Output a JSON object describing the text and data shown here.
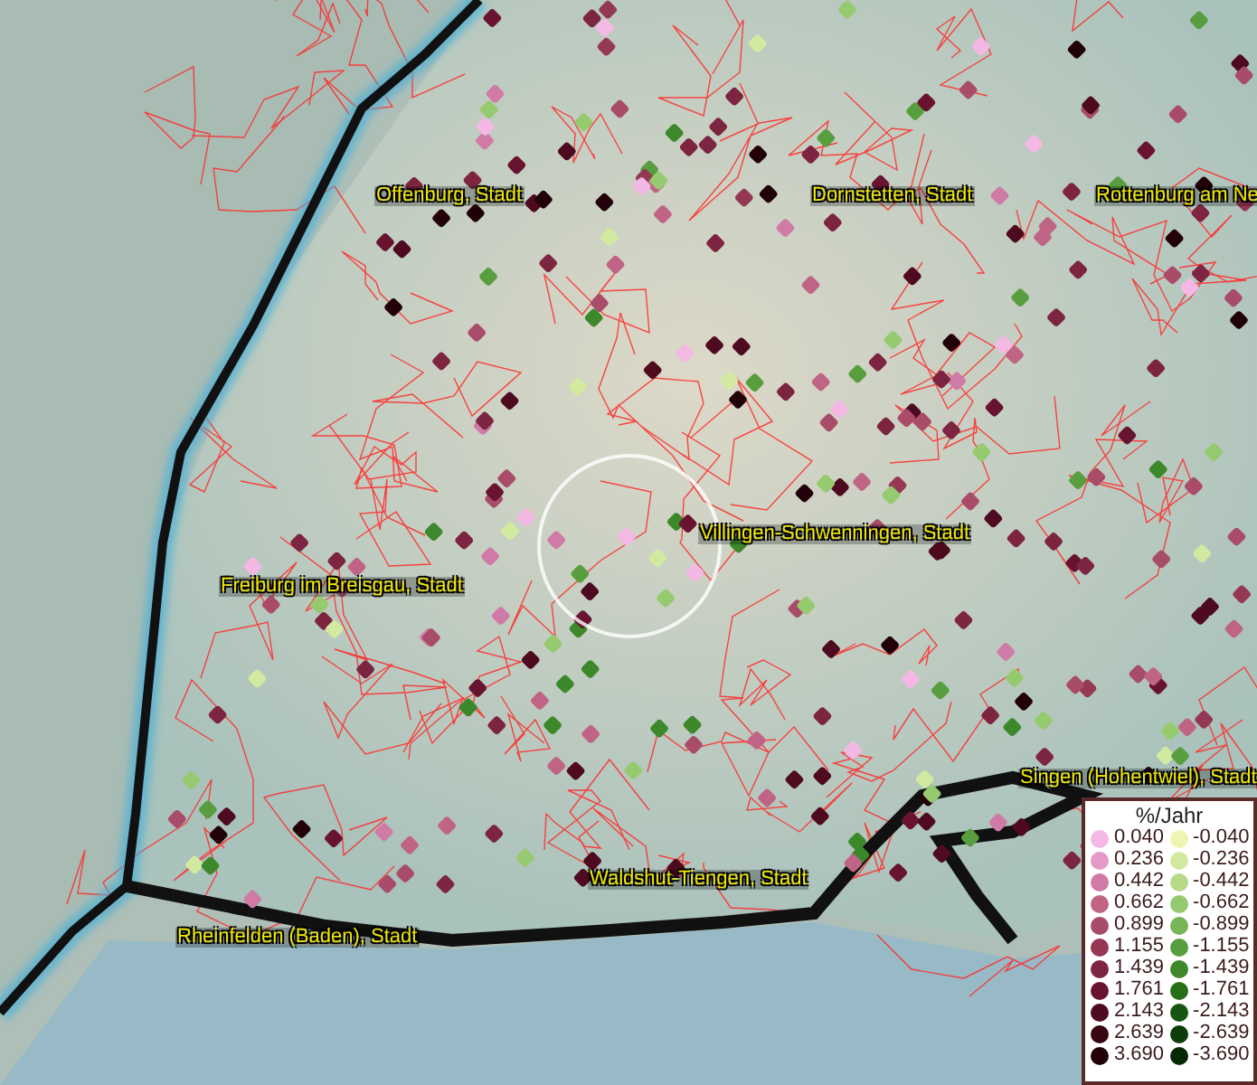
{
  "map": {
    "places": [
      {
        "name": "Offenburg, Stadt",
        "kind": "city"
      },
      {
        "name": "Dornstetten, Stadt",
        "kind": "city"
      },
      {
        "name": "Rottenburg am Ne",
        "kind": "city"
      },
      {
        "name": "Villingen-Schwenningen, Stadt",
        "kind": "city"
      },
      {
        "name": "Freiburg im Breisgau, Stadt",
        "kind": "city"
      },
      {
        "name": "Singen (Hohentwiel), Stadt",
        "kind": "city"
      },
      {
        "name": "Waldshut-Tiengen, Stadt",
        "kind": "city"
      },
      {
        "name": "Rheinfelden (Baden), Stadt",
        "kind": "city"
      }
    ]
  },
  "legend": {
    "title": "%/Jahr",
    "positive": [
      {
        "label": "0.040",
        "color": "#f4b8e4"
      },
      {
        "label": "0.236",
        "color": "#e49ac8"
      },
      {
        "label": "0.442",
        "color": "#d07aa6"
      },
      {
        "label": "0.662",
        "color": "#c06486"
      },
      {
        "label": "0.899",
        "color": "#a84c6a"
      },
      {
        "label": "1.155",
        "color": "#943854"
      },
      {
        "label": "1.439",
        "color": "#7c2440"
      },
      {
        "label": "1.761",
        "color": "#681430"
      },
      {
        "label": "2.143",
        "color": "#4e0a1e"
      },
      {
        "label": "2.639",
        "color": "#380510"
      },
      {
        "label": "3.690",
        "color": "#220008"
      }
    ],
    "negative": [
      {
        "label": "-0.040",
        "color": "#eef5b0"
      },
      {
        "label": "-0.236",
        "color": "#d2eaa0"
      },
      {
        "label": "-0.442",
        "color": "#b6da88"
      },
      {
        "label": "-0.662",
        "color": "#96ca6e"
      },
      {
        "label": "-0.899",
        "color": "#76b656"
      },
      {
        "label": "-1.155",
        "color": "#589e3e"
      },
      {
        "label": "-1.439",
        "color": "#3c882a"
      },
      {
        "label": "-1.761",
        "color": "#266e18"
      },
      {
        "label": "-2.143",
        "color": "#165610"
      },
      {
        "label": "-2.639",
        "color": "#0c3e08"
      },
      {
        "label": "-3.690",
        "color": "#062804"
      }
    ]
  }
}
